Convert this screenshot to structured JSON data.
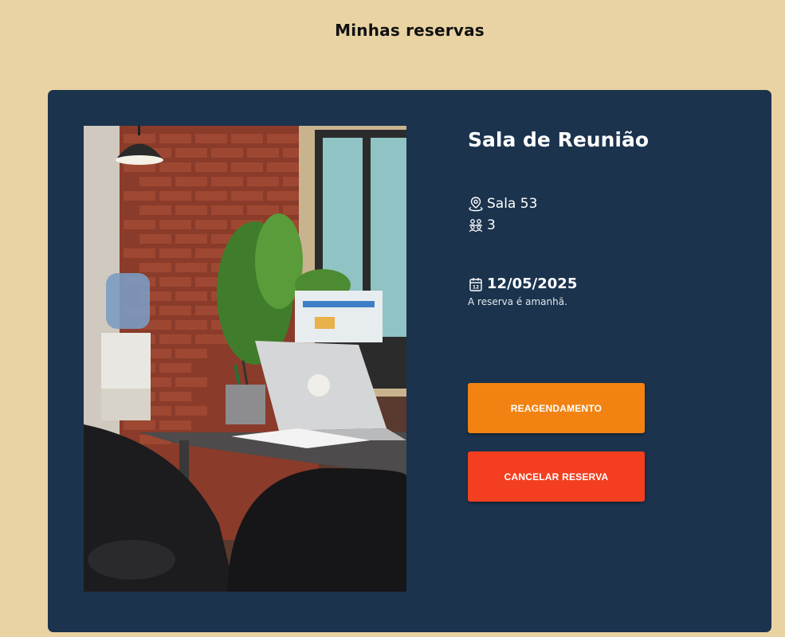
{
  "page": {
    "title": "Minhas reservas"
  },
  "reservation": {
    "room_name": "Sala de Reunião",
    "location": "Sala 53",
    "capacity": "3",
    "date": "12/05/2025",
    "date_note": "A reserva é amanhã.",
    "image": "office-meeting-room-photo"
  },
  "actions": {
    "reschedule_label": "REAGENDAMENTO",
    "cancel_label": "CANCELAR RESERVA"
  },
  "colors": {
    "background": "#e9d3a3",
    "card": "#1b334d",
    "reschedule": "#f28313",
    "cancel": "#f33f20"
  },
  "icons": {
    "location": "map-pin-icon",
    "capacity": "people-icon",
    "date": "calendar-icon"
  }
}
